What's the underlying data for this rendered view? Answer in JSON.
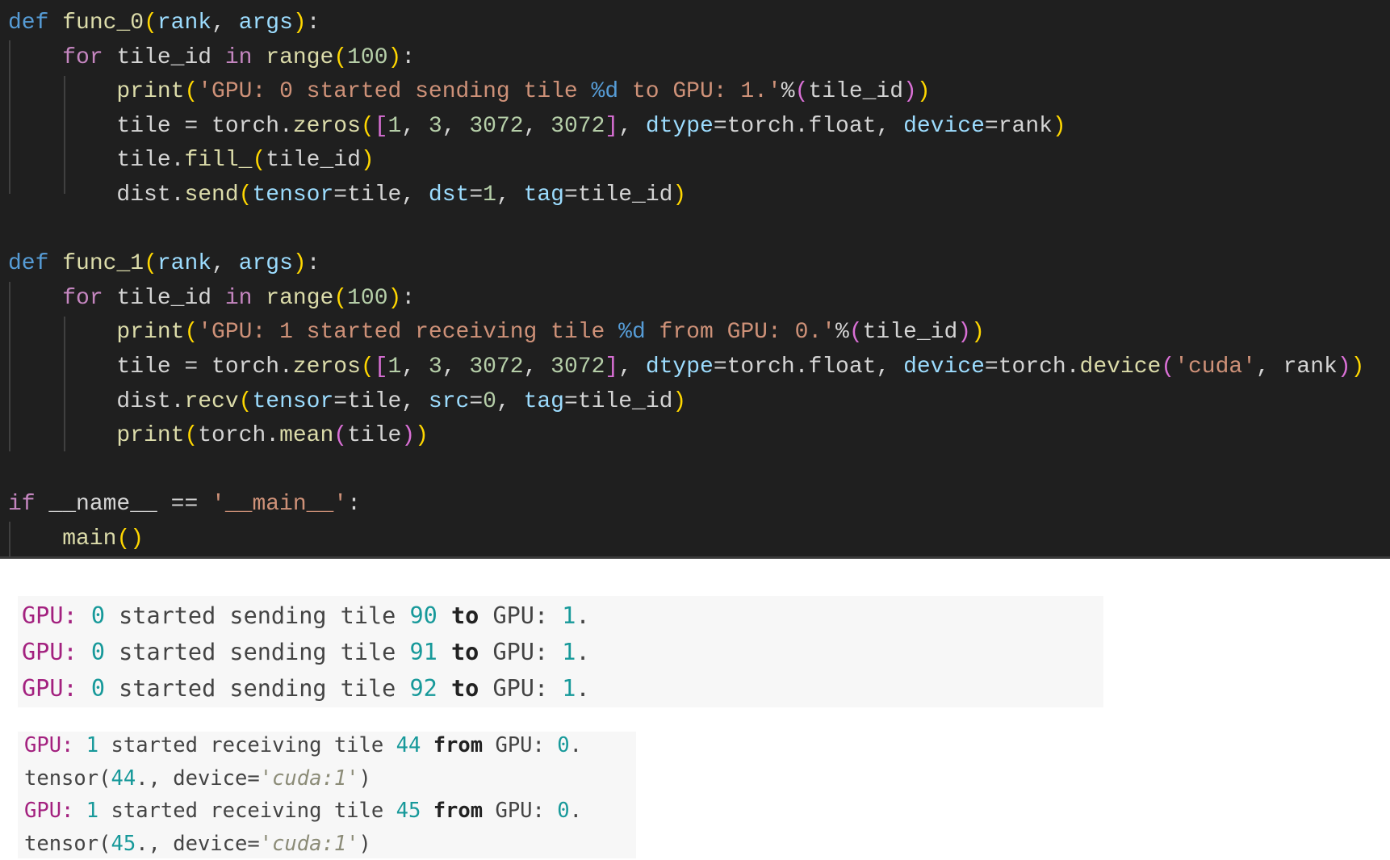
{
  "editor": {
    "lines": [
      [
        [
          "def",
          "kw"
        ],
        [
          " ",
          "pl"
        ],
        [
          "func_0",
          "fn"
        ],
        [
          "(",
          "b1"
        ],
        [
          "rank",
          "var"
        ],
        [
          ", ",
          "pl"
        ],
        [
          "args",
          "var"
        ],
        [
          ")",
          "b1"
        ],
        [
          ":",
          "pl"
        ]
      ],
      [
        [
          "    ",
          "pl"
        ],
        [
          "for",
          "ctl"
        ],
        [
          " tile_id ",
          "pl"
        ],
        [
          "in",
          "ctl"
        ],
        [
          " ",
          "pl"
        ],
        [
          "range",
          "fn"
        ],
        [
          "(",
          "b1"
        ],
        [
          "100",
          "num"
        ],
        [
          ")",
          "b1"
        ],
        [
          ":",
          "pl"
        ]
      ],
      [
        [
          "        ",
          "pl"
        ],
        [
          "print",
          "fn"
        ],
        [
          "(",
          "b1"
        ],
        [
          "'GPU: 0 started sending tile ",
          "str"
        ],
        [
          "%d",
          "fmt"
        ],
        [
          " to GPU: 1.'",
          "str"
        ],
        [
          "%",
          "pl"
        ],
        [
          "(",
          "b2"
        ],
        [
          "tile_id",
          "pl"
        ],
        [
          ")",
          "b2"
        ],
        [
          ")",
          "b1"
        ]
      ],
      [
        [
          "        tile = torch.",
          "pl"
        ],
        [
          "zeros",
          "fn"
        ],
        [
          "(",
          "b1"
        ],
        [
          "[",
          "b2"
        ],
        [
          "1",
          "num"
        ],
        [
          ", ",
          "pl"
        ],
        [
          "3",
          "num"
        ],
        [
          ", ",
          "pl"
        ],
        [
          "3072",
          "num"
        ],
        [
          ", ",
          "pl"
        ],
        [
          "3072",
          "num"
        ],
        [
          "]",
          "b2"
        ],
        [
          ", ",
          "pl"
        ],
        [
          "dtype",
          "var"
        ],
        [
          "=torch.float, ",
          "pl"
        ],
        [
          "device",
          "var"
        ],
        [
          "=rank",
          "pl"
        ],
        [
          ")",
          "b1"
        ]
      ],
      [
        [
          "        tile.",
          "pl"
        ],
        [
          "fill_",
          "fn"
        ],
        [
          "(",
          "b1"
        ],
        [
          "tile_id",
          "pl"
        ],
        [
          ")",
          "b1"
        ]
      ],
      [
        [
          "        dist.",
          "pl"
        ],
        [
          "send",
          "fn"
        ],
        [
          "(",
          "b1"
        ],
        [
          "tensor",
          "var"
        ],
        [
          "=tile, ",
          "pl"
        ],
        [
          "dst",
          "var"
        ],
        [
          "=",
          "pl"
        ],
        [
          "1",
          "num"
        ],
        [
          ", ",
          "pl"
        ],
        [
          "tag",
          "var"
        ],
        [
          "=tile_id",
          "pl"
        ],
        [
          ")",
          "b1"
        ]
      ],
      [],
      [
        [
          "def",
          "kw"
        ],
        [
          " ",
          "pl"
        ],
        [
          "func_1",
          "fn"
        ],
        [
          "(",
          "b1"
        ],
        [
          "rank",
          "var"
        ],
        [
          ", ",
          "pl"
        ],
        [
          "args",
          "var"
        ],
        [
          ")",
          "b1"
        ],
        [
          ":",
          "pl"
        ]
      ],
      [
        [
          "    ",
          "pl"
        ],
        [
          "for",
          "ctl"
        ],
        [
          " tile_id ",
          "pl"
        ],
        [
          "in",
          "ctl"
        ],
        [
          " ",
          "pl"
        ],
        [
          "range",
          "fn"
        ],
        [
          "(",
          "b1"
        ],
        [
          "100",
          "num"
        ],
        [
          ")",
          "b1"
        ],
        [
          ":",
          "pl"
        ]
      ],
      [
        [
          "        ",
          "pl"
        ],
        [
          "print",
          "fn"
        ],
        [
          "(",
          "b1"
        ],
        [
          "'GPU: 1 started receiving tile ",
          "str"
        ],
        [
          "%d",
          "fmt"
        ],
        [
          " from GPU: 0.'",
          "str"
        ],
        [
          "%",
          "pl"
        ],
        [
          "(",
          "b2"
        ],
        [
          "tile_id",
          "pl"
        ],
        [
          ")",
          "b2"
        ],
        [
          ")",
          "b1"
        ]
      ],
      [
        [
          "        tile = torch.",
          "pl"
        ],
        [
          "zeros",
          "fn"
        ],
        [
          "(",
          "b1"
        ],
        [
          "[",
          "b2"
        ],
        [
          "1",
          "num"
        ],
        [
          ", ",
          "pl"
        ],
        [
          "3",
          "num"
        ],
        [
          ", ",
          "pl"
        ],
        [
          "3072",
          "num"
        ],
        [
          ", ",
          "pl"
        ],
        [
          "3072",
          "num"
        ],
        [
          "]",
          "b2"
        ],
        [
          ", ",
          "pl"
        ],
        [
          "dtype",
          "var"
        ],
        [
          "=torch.float, ",
          "pl"
        ],
        [
          "device",
          "var"
        ],
        [
          "=torch.",
          "pl"
        ],
        [
          "device",
          "fn"
        ],
        [
          "(",
          "b2"
        ],
        [
          "'cuda'",
          "str"
        ],
        [
          ", rank",
          "pl"
        ],
        [
          ")",
          "b2"
        ],
        [
          ")",
          "b1"
        ]
      ],
      [
        [
          "        dist.",
          "pl"
        ],
        [
          "recv",
          "fn"
        ],
        [
          "(",
          "b1"
        ],
        [
          "tensor",
          "var"
        ],
        [
          "=tile, ",
          "pl"
        ],
        [
          "src",
          "var"
        ],
        [
          "=",
          "pl"
        ],
        [
          "0",
          "num"
        ],
        [
          ", ",
          "pl"
        ],
        [
          "tag",
          "var"
        ],
        [
          "=tile_id",
          "pl"
        ],
        [
          ")",
          "b1"
        ]
      ],
      [
        [
          "        ",
          "pl"
        ],
        [
          "print",
          "fn"
        ],
        [
          "(",
          "b1"
        ],
        [
          "torch.",
          "pl"
        ],
        [
          "mean",
          "fn"
        ],
        [
          "(",
          "b2"
        ],
        [
          "tile",
          "pl"
        ],
        [
          ")",
          "b2"
        ],
        [
          ")",
          "b1"
        ]
      ],
      [],
      [
        [
          "if",
          "ctl"
        ],
        [
          " __name__ == ",
          "pl"
        ],
        [
          "'__main__'",
          "str"
        ],
        [
          ":",
          "pl"
        ]
      ],
      [
        [
          "    ",
          "pl"
        ],
        [
          "main",
          "fn"
        ],
        [
          "()",
          "b1"
        ]
      ]
    ]
  },
  "output_send": [
    [
      [
        "GPU:",
        "mg"
      ],
      [
        " ",
        "tx"
      ],
      [
        "0",
        "tl"
      ],
      [
        " started sending tile ",
        "tx"
      ],
      [
        "90",
        "tl"
      ],
      [
        " ",
        "tx"
      ],
      [
        "to",
        "bd"
      ],
      [
        " GPU: ",
        "tx"
      ],
      [
        "1",
        "tl"
      ],
      [
        ".",
        "tx"
      ]
    ],
    [
      [
        "GPU:",
        "mg"
      ],
      [
        " ",
        "tx"
      ],
      [
        "0",
        "tl"
      ],
      [
        " started sending tile ",
        "tx"
      ],
      [
        "91",
        "tl"
      ],
      [
        " ",
        "tx"
      ],
      [
        "to",
        "bd"
      ],
      [
        " GPU: ",
        "tx"
      ],
      [
        "1",
        "tl"
      ],
      [
        ".",
        "tx"
      ]
    ],
    [
      [
        "GPU:",
        "mg"
      ],
      [
        " ",
        "tx"
      ],
      [
        "0",
        "tl"
      ],
      [
        " started sending tile ",
        "tx"
      ],
      [
        "92",
        "tl"
      ],
      [
        " ",
        "tx"
      ],
      [
        "to",
        "bd"
      ],
      [
        " GPU: ",
        "tx"
      ],
      [
        "1",
        "tl"
      ],
      [
        ".",
        "tx"
      ]
    ]
  ],
  "output_recv": [
    [
      [
        "GPU:",
        "mg"
      ],
      [
        " ",
        "tx"
      ],
      [
        "1",
        "tl"
      ],
      [
        " started receiving tile ",
        "tx"
      ],
      [
        "44",
        "tl"
      ],
      [
        " ",
        "tx"
      ],
      [
        "from",
        "bd"
      ],
      [
        " GPU: ",
        "tx"
      ],
      [
        "0",
        "tl"
      ],
      [
        ".",
        "tx"
      ]
    ],
    [
      [
        "tensor(",
        "tx"
      ],
      [
        "44",
        "tl"
      ],
      [
        "., device=",
        "tx"
      ],
      [
        "'cuda:1'",
        "it"
      ],
      [
        ")",
        "tx"
      ]
    ],
    [
      [
        "GPU:",
        "mg"
      ],
      [
        " ",
        "tx"
      ],
      [
        "1",
        "tl"
      ],
      [
        " started receiving tile ",
        "tx"
      ],
      [
        "45",
        "tl"
      ],
      [
        " ",
        "tx"
      ],
      [
        "from",
        "bd"
      ],
      [
        " GPU: ",
        "tx"
      ],
      [
        "0",
        "tl"
      ],
      [
        ".",
        "tx"
      ]
    ],
    [
      [
        "tensor(",
        "tx"
      ],
      [
        "45",
        "tl"
      ],
      [
        "., device=",
        "tx"
      ],
      [
        "'cuda:1'",
        "it"
      ],
      [
        ")",
        "tx"
      ]
    ]
  ],
  "colors": {
    "editor_bg": "#1f1f1f",
    "output_bg": "#f7f7f7",
    "gpu_label": "#a3217f",
    "number": "#17999a"
  }
}
